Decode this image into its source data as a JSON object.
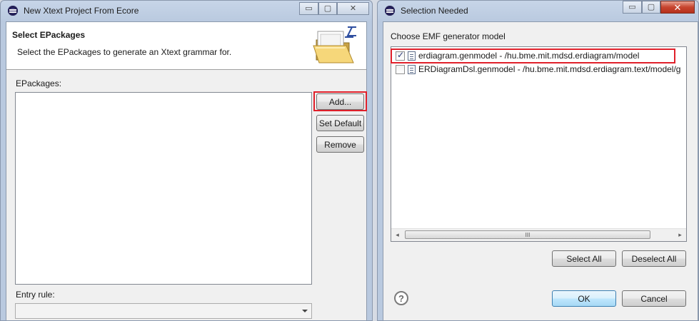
{
  "left_window": {
    "title": "New Xtext Project From Ecore",
    "header_title": "Select EPackages",
    "header_description": "Select the EPackages to generate an Xtext grammar for.",
    "epackages_label": "EPackages:",
    "buttons": {
      "add": "Add...",
      "set_default": "Set Default",
      "remove": "Remove"
    },
    "entry_rule_label": "Entry rule:",
    "entry_rule_value": ""
  },
  "right_window": {
    "title": "Selection Needed",
    "prompt": "Choose EMF generator model",
    "items": [
      {
        "label": "erdiagram.genmodel - /hu.bme.mit.mdsd.erdiagram/model",
        "checked": true
      },
      {
        "label": "ERDiagramDsl.genmodel - /hu.bme.mit.mdsd.erdiagram.text/model/g",
        "checked": false
      }
    ],
    "scroll_thumb_grip": "III",
    "buttons": {
      "select_all": "Select All",
      "deselect_all": "Deselect All",
      "ok": "OK",
      "cancel": "Cancel"
    },
    "help_symbol": "?"
  },
  "icons": {
    "app": "eclipse-icon",
    "wizard": "open-folder-icon",
    "item": "genmodel-file-icon",
    "help": "help-icon"
  },
  "caption_glyphs": {
    "minimize": "▭",
    "maximize": "▢",
    "close": "✕"
  },
  "scroll_glyphs": {
    "left": "◂",
    "right": "▸"
  },
  "colors": {
    "highlight": "#e0202a",
    "default_button": "#3c7fb1"
  }
}
